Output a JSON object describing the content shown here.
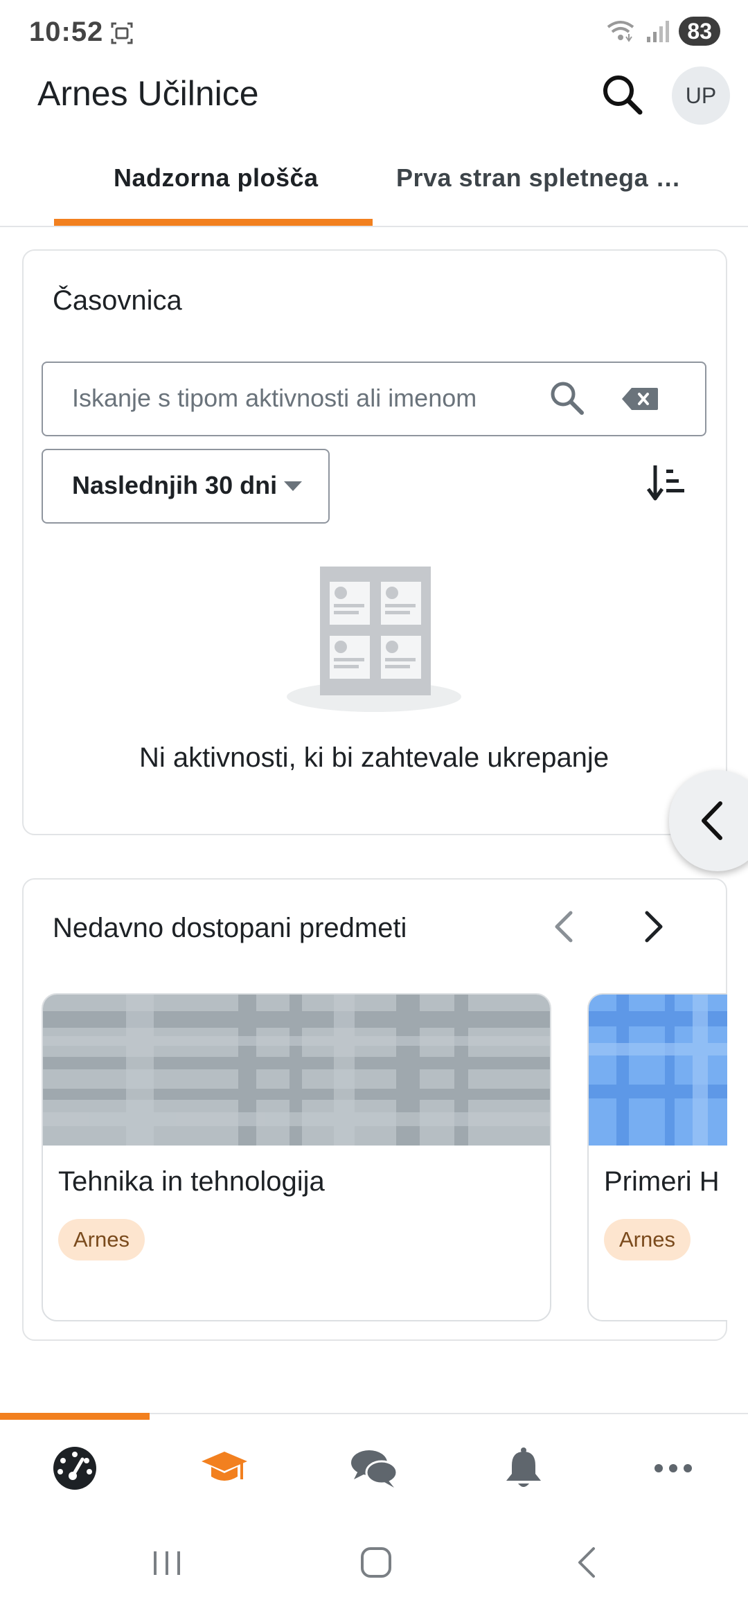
{
  "status_bar": {
    "time": "10:52",
    "battery": "83"
  },
  "header": {
    "title": "Arnes Učilnice",
    "avatar_initials": "UP"
  },
  "tabs": [
    {
      "label": "Nadzorna plošča",
      "active": true
    },
    {
      "label": "Prva stran spletnega …",
      "active": false
    }
  ],
  "timeline": {
    "title": "Časovnica",
    "search_placeholder": "Iskanje s tipom aktivnosti ali imenom",
    "filter": "Naslednjih 30 dni",
    "empty_message": "Ni aktivnosti, ki bi zahtevale ukrepanje"
  },
  "recent_courses": {
    "title": "Nedavno dostopani predmeti",
    "courses": [
      {
        "name": "Tehnika in tehnologija",
        "category": "Arnes"
      },
      {
        "name": "Primeri H",
        "category": "Arnes"
      }
    ]
  },
  "bottom_nav": {
    "items": [
      {
        "icon": "dashboard-icon",
        "active": true
      },
      {
        "icon": "graduation-cap-icon",
        "active": false
      },
      {
        "icon": "messages-icon",
        "active": false
      },
      {
        "icon": "bell-icon",
        "active": false
      },
      {
        "icon": "more-icon",
        "active": false
      }
    ]
  },
  "colors": {
    "accent": "#f2801f",
    "badge_bg": "#fde5cf"
  }
}
